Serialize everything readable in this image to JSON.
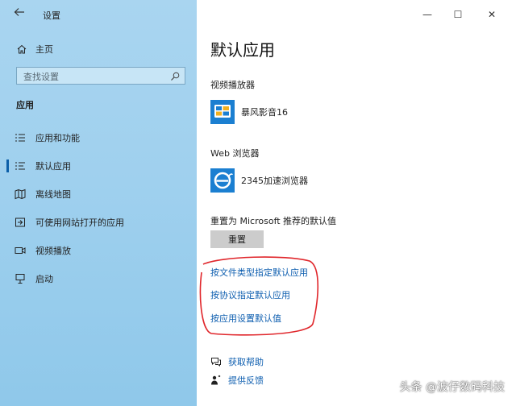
{
  "window": {
    "app_title": "设置",
    "back_icon": "back-arrow-icon",
    "controls": {
      "minimize": "—",
      "maximize": "☐",
      "close": "✕"
    }
  },
  "sidebar": {
    "home_label": "主页",
    "search_placeholder": "查找设置",
    "section_label": "应用",
    "items": [
      {
        "label": "应用和功能",
        "icon": "list-icon"
      },
      {
        "label": "默认应用",
        "icon": "list-icon",
        "selected": true
      },
      {
        "label": "离线地图",
        "icon": "map-icon"
      },
      {
        "label": "可使用网站打开的应用",
        "icon": "open-in-icon"
      },
      {
        "label": "视频播放",
        "icon": "video-icon"
      },
      {
        "label": "启动",
        "icon": "startup-icon"
      }
    ]
  },
  "content": {
    "title": "默认应用",
    "video_player_heading": "视频播放器",
    "video_player_app": "暴风影音16",
    "web_browser_heading": "Web 浏览器",
    "web_browser_app": "2345加速浏览器",
    "reset_heading": "重置为 Microsoft 推荐的默认值",
    "reset_button": "重置",
    "links": [
      "按文件类型指定默认应用",
      "按协议指定默认应用",
      "按应用设置默认值"
    ],
    "help": {
      "get_help": "获取帮助",
      "feedback": "提供反馈"
    }
  },
  "annotation": {
    "color": "#e0262b"
  },
  "watermark": "头条 @波仔数码科技"
}
